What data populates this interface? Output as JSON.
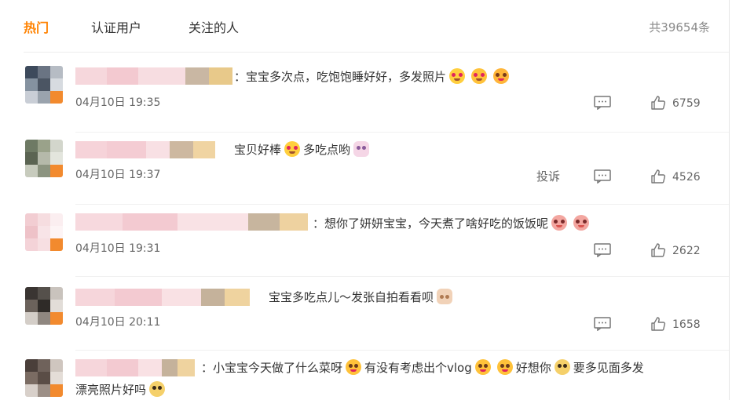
{
  "tabs": [
    {
      "label": "热门",
      "active": true
    },
    {
      "label": "认证用户",
      "active": false
    },
    {
      "label": "关注的人",
      "active": false
    }
  ],
  "total_count": "共39654条",
  "colors": {
    "accent": "#ff8200",
    "muted": "#8a8a8a",
    "text": "#333333"
  },
  "comments": [
    {
      "text_prefix": "：宝宝多次点，吃饱饱睡好好，多发照片",
      "emojis": [
        "heart-eyes-emoji",
        "heart-eyes-emoji",
        "kiss-emoji"
      ],
      "text_suffix": "",
      "time": "04月10日 19:35",
      "show_report": false,
      "likes": "6759"
    },
    {
      "text_prefix": "宝贝好棒",
      "emojis": [
        "heart-eyes-emoji"
      ],
      "text_suffix": "多吃点哟",
      "trailing_emojis": [
        "bunny-emoji"
      ],
      "time": "04月10日 19:37",
      "show_report": true,
      "report_label": "投诉",
      "likes": "4526"
    },
    {
      "text_prefix": "：想你了妍妍宝宝，今天煮了啥好吃的饭饭呢",
      "emojis": [
        "pig-emoji",
        "pig-emoji"
      ],
      "text_suffix": "",
      "time": "04月10日 19:31",
      "show_report": false,
      "likes": "2622"
    },
    {
      "text_prefix": "宝宝多吃点儿～发张自拍看看呗",
      "emojis": [
        "hands-emoji"
      ],
      "text_suffix": "",
      "time": "04月10日 20:11",
      "show_report": false,
      "likes": "1658"
    },
    {
      "text_line1": "：小宝宝今天做了什么菜呀",
      "text_line1b": "有没有考虑出个vlog",
      "text_line1c": "好想你",
      "text_line1d": "要多见面多发",
      "text_line2": "漂亮照片好吗",
      "time": "",
      "show_report": false,
      "likes": ""
    }
  ]
}
